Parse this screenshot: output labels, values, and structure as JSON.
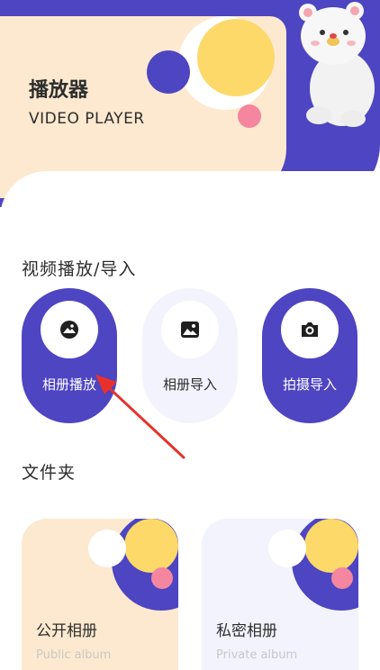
{
  "header": {
    "title": "播放器",
    "subtitle": "VIDEO PLAYER"
  },
  "import_section": {
    "title": "视频播放/导入",
    "items": [
      {
        "label": "相册播放",
        "icon": "gallery-icon"
      },
      {
        "label": "相册导入",
        "icon": "image-icon"
      },
      {
        "label": "拍摄导入",
        "icon": "camera-icon"
      }
    ]
  },
  "folder_section": {
    "title": "文件夹",
    "albums": [
      {
        "title": "公开相册",
        "subtitle": "Public album"
      },
      {
        "title": "私密相册",
        "subtitle": "Private album"
      }
    ]
  },
  "colors": {
    "accent": "#4d45c1",
    "peach": "#fde9cf",
    "yellow": "#fcd969",
    "pink": "#f4869f",
    "lilac": "#f3f3fe"
  }
}
